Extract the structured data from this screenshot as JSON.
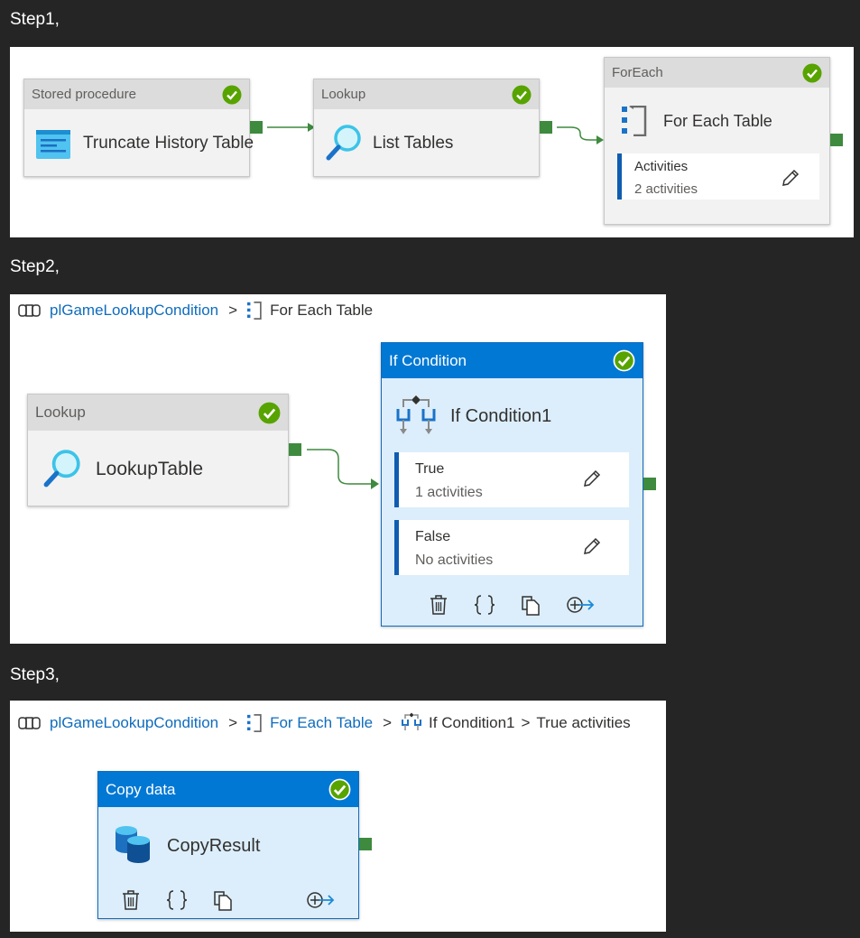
{
  "steps": [
    {
      "label": "Step1,"
    },
    {
      "label": "Step2,"
    },
    {
      "label": "Step3,"
    }
  ],
  "step1": {
    "stored_proc": {
      "type": "Stored procedure",
      "name": "Truncate History Table",
      "status": "succeeded"
    },
    "lookup": {
      "type": "Lookup",
      "name": "List Tables",
      "status": "succeeded"
    },
    "foreach": {
      "type": "ForEach",
      "name": "For Each Table",
      "status": "succeeded",
      "activities": {
        "title": "Activities",
        "count": "2 activities"
      }
    }
  },
  "step2": {
    "breadcrumb": {
      "pipeline": "plGameLookupCondition",
      "sep": ">",
      "current": "For Each Table"
    },
    "lookup": {
      "type": "Lookup",
      "name": "LookupTable",
      "status": "succeeded"
    },
    "if_condition": {
      "type": "If Condition",
      "name": "If Condition1",
      "status": "succeeded",
      "true_branch": {
        "title": "True",
        "count": "1 activities"
      },
      "false_branch": {
        "title": "False",
        "count": "No activities"
      }
    }
  },
  "step3": {
    "breadcrumb": {
      "pipeline": "plGameLookupCondition",
      "sep": ">",
      "foreach": "For Each Table",
      "if_condition": "If Condition1",
      "current": "True activities"
    },
    "copy": {
      "type": "Copy data",
      "name": "CopyResult",
      "status": "succeeded"
    }
  },
  "colors": {
    "accent": "#0078d4",
    "link": "#0f6cbd",
    "success": "#57a300",
    "port": "#3e8a3e",
    "background": "#252526",
    "selected_fill": "#dceefb"
  },
  "icons": [
    "stored-procedure-icon",
    "lookup-icon",
    "foreach-icon",
    "if-condition-icon",
    "copy-data-icon",
    "pipeline-icon",
    "success-check-icon",
    "edit-pencil-icon",
    "delete-icon",
    "code-icon",
    "clone-icon",
    "add-output-icon"
  ]
}
